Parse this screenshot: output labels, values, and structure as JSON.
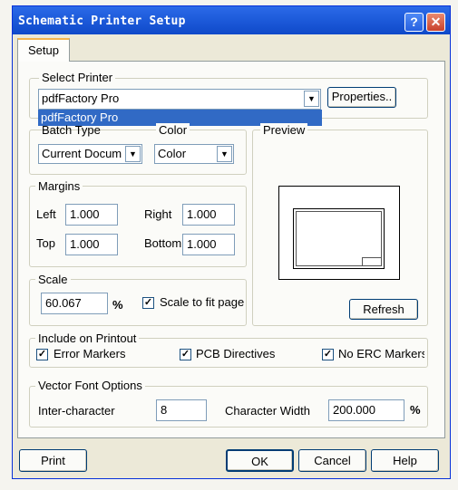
{
  "window": {
    "title": "Schematic Printer Setup",
    "help_glyph": "?",
    "close_glyph": "✕"
  },
  "tab": {
    "label": "Setup"
  },
  "select_printer": {
    "label": "Select Printer",
    "selected": "pdfFactory Pro",
    "dropdown_highlight": "pdfFactory Pro",
    "properties_label": "Properties.."
  },
  "batch_type": {
    "label": "Batch Type",
    "value": "Current Docum"
  },
  "color": {
    "label": "Color",
    "value": "Color"
  },
  "preview": {
    "label": "Preview",
    "refresh_label": "Refresh"
  },
  "margins": {
    "label": "Margins",
    "left_label": "Left",
    "left_value": "1.000",
    "right_label": "Right",
    "right_value": "1.000",
    "top_label": "Top",
    "top_value": "1.000",
    "bottom_label": "Bottom",
    "bottom_value": "1.000"
  },
  "scale": {
    "label": "Scale",
    "value": "60.067",
    "unit": "%",
    "fit_label": "Scale to fit page",
    "fit_checked": true
  },
  "include": {
    "label": "Include on Printout",
    "items": [
      {
        "label": "Error Markers",
        "checked": true
      },
      {
        "label": "PCB Directives",
        "checked": true
      },
      {
        "label": "No ERC Markers",
        "checked": true
      }
    ]
  },
  "vector_font": {
    "label": "Vector Font Options",
    "inter_label": "Inter-character",
    "inter_value": "8",
    "width_label": "Character Width",
    "width_value": "200.000",
    "unit": "%"
  },
  "buttons": {
    "print": "Print",
    "ok": "OK",
    "cancel": "Cancel",
    "help": "Help"
  },
  "colors": {
    "title_bar": "#1f5ddc",
    "selection": "#316ac5"
  }
}
